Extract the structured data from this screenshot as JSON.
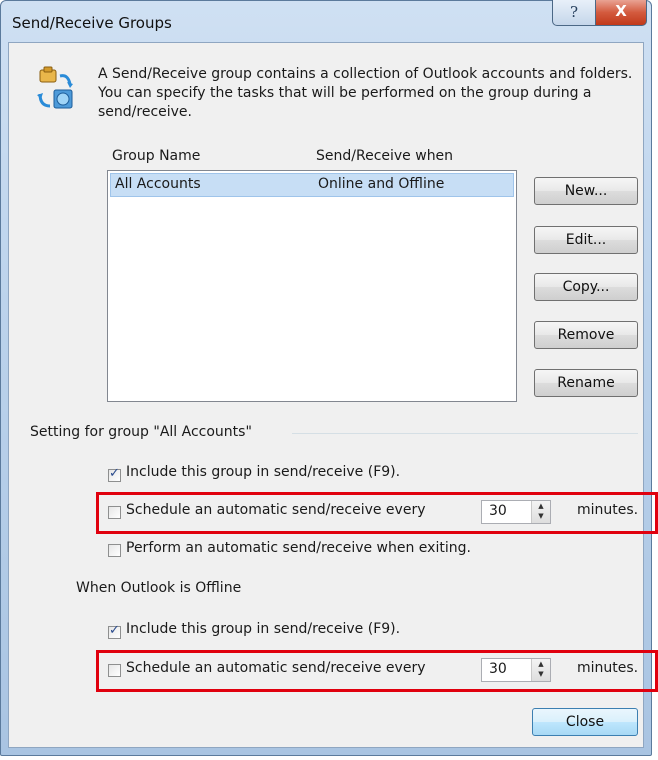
{
  "window": {
    "title": "Send/Receive Groups",
    "help_glyph": "?",
    "close_glyph": "X"
  },
  "description": "A Send/Receive group contains a collection of Outlook accounts and folders. You can specify the tasks that will be performed on the group during a send/receive.",
  "list": {
    "headers": [
      "Group Name",
      "Send/Receive when"
    ],
    "rows": [
      {
        "name": "All Accounts",
        "when": "Online and Offline",
        "selected": true
      }
    ]
  },
  "buttons": {
    "new": "New...",
    "edit": "Edit...",
    "copy": "Copy...",
    "remove": "Remove",
    "rename": "Rename",
    "close": "Close"
  },
  "settings": {
    "group_label": "Setting for group \"All Accounts\"",
    "online": {
      "include_label": "Include this group in send/receive (F9).",
      "include_checked": true,
      "schedule_label": "Schedule an automatic send/receive every",
      "schedule_checked": false,
      "schedule_value": "30",
      "minutes_label": "minutes.",
      "exit_label": "Perform an automatic send/receive when exiting.",
      "exit_checked": false
    },
    "offline_heading": "When Outlook is Offline",
    "offline": {
      "include_label": "Include this group in send/receive (F9).",
      "include_checked": true,
      "schedule_label": "Schedule an automatic send/receive every",
      "schedule_checked": false,
      "schedule_value": "30",
      "minutes_label": "minutes."
    }
  },
  "colors": {
    "highlight_box": "#e0000e",
    "selected_row": "#c7def5",
    "close_button_border": "#3c7fb1"
  }
}
